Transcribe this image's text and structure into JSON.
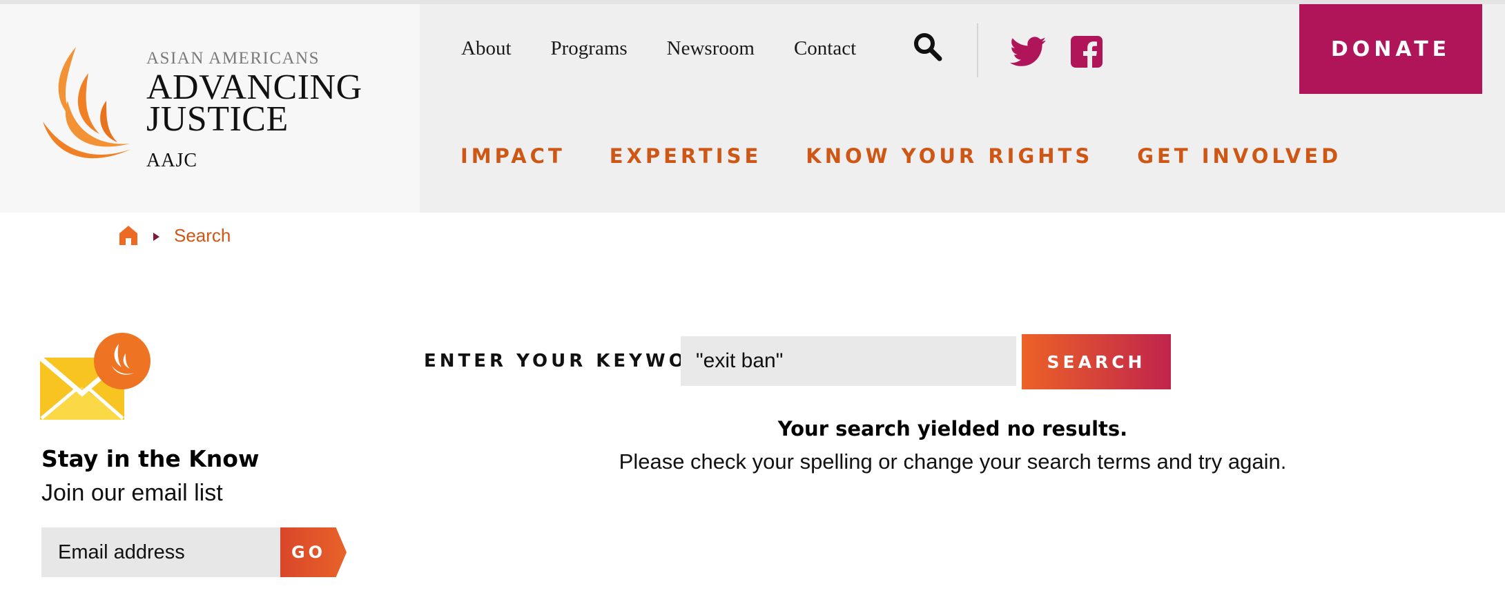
{
  "header": {
    "logo": {
      "line1": "ASIAN AMERICANS",
      "line2": "ADVANCING",
      "line3": "JUSTICE",
      "line4": "AAJC"
    },
    "utility_nav": [
      "About",
      "Programs",
      "Newsroom",
      "Contact"
    ],
    "donate_label": "DONATE",
    "main_nav": [
      "IMPACT",
      "EXPERTISE",
      "KNOW YOUR RIGHTS",
      "GET INVOLVED"
    ],
    "icons": [
      "search-icon",
      "twitter-icon",
      "facebook-icon"
    ]
  },
  "breadcrumb": {
    "home_icon": "home-icon",
    "current": "Search"
  },
  "signup": {
    "icon": "envelope-icon",
    "title": "Stay in the Know",
    "subtitle": "Join our email list",
    "email_placeholder": "Email address",
    "go_label": "GO"
  },
  "search": {
    "label": "ENTER YOUR KEYWORDS",
    "query": "\"exit ban\"",
    "button_label": "SEARCH",
    "no_results_title": "Your search yielded no results.",
    "no_results_hint": "Please check your spelling or change your search terms and try again."
  },
  "colors": {
    "brand_orange": "#cf5716",
    "donate_magenta": "#b0155a",
    "nav_bg": "#efefef",
    "logo_bg": "#f7f7f7"
  }
}
